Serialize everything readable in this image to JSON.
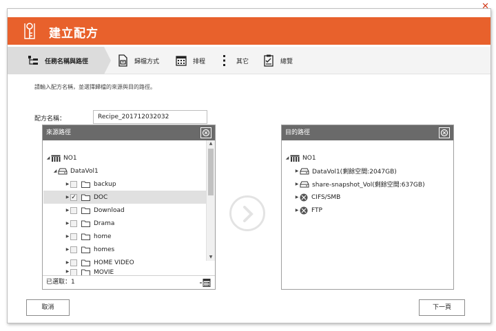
{
  "dialog": {
    "title": "建立配方",
    "close_symbol": "✕"
  },
  "steps": [
    {
      "label": "任務名稱與路徑",
      "icon": "tree-hierarchy-icon",
      "active": true
    },
    {
      "label": "歸檔方式",
      "icon": "document-archive-icon",
      "active": false
    },
    {
      "label": "排程",
      "icon": "calendar-icon",
      "active": false
    },
    {
      "label": "其它",
      "icon": "more-vertical-icon",
      "active": false
    },
    {
      "label": "總覽",
      "icon": "checklist-icon",
      "active": false
    }
  ],
  "form": {
    "instruction": "請輸入配方名稱，並選擇歸檔的來源與目的路徑。",
    "name_label": "配方名稱：",
    "name_value": "Recipe_201712032032"
  },
  "source_panel": {
    "title": "來源路徑",
    "root": "NO1",
    "volume": "DataVol1",
    "folders": [
      {
        "name": "backup",
        "checked": false
      },
      {
        "name": "DOC",
        "checked": true,
        "selected": true
      },
      {
        "name": "Download",
        "checked": false
      },
      {
        "name": "Drama",
        "checked": false
      },
      {
        "name": "home",
        "checked": false
      },
      {
        "name": "homes",
        "checked": false
      },
      {
        "name": "HOME VIDEO",
        "checked": false
      },
      {
        "name": "MOVIE",
        "checked": false
      }
    ],
    "selected_count_label": "已選取：1",
    "check_mark": "✓"
  },
  "dest_panel": {
    "title": "目的路徑",
    "root": "NO1",
    "items": [
      {
        "name": "DataVol1(剩餘空間:2047GB)",
        "icon": "drive-icon"
      },
      {
        "name": "share-snapshot_Vol(剩餘空間:637GB)",
        "icon": "drive-icon"
      },
      {
        "name": "CIFS/SMB",
        "icon": "network-icon"
      },
      {
        "name": "FTP",
        "icon": "network-icon"
      }
    ]
  },
  "buttons": {
    "cancel": "取消",
    "next": "下一頁"
  },
  "colors": {
    "header": "#e8612c",
    "panel_header": "#6a6a6a"
  }
}
